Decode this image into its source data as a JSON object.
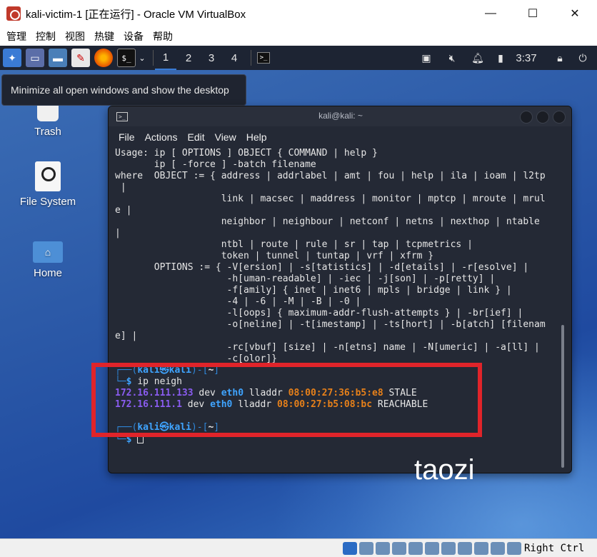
{
  "window": {
    "title": "kali-victim-1 [正在运行] - Oracle VM VirtualBox",
    "minimize": "—",
    "maximize": "☐",
    "close": "✕"
  },
  "menubar": [
    "管理",
    "控制",
    "视图",
    "热键",
    "设备",
    "帮助"
  ],
  "panel": {
    "workspaces": [
      "1",
      "2",
      "3",
      "4"
    ],
    "active_workspace": "1",
    "clock": "3:37",
    "icons": [
      "kali-menu-icon",
      "show-desktop-icon",
      "files-icon",
      "text-editor-icon",
      "firefox-icon",
      "terminal-icon",
      "chevron-down-icon",
      "terminal-task-icon",
      "network-icon",
      "mute-icon",
      "notification-icon",
      "battery-icon",
      "lock-icon",
      "power-icon"
    ]
  },
  "tooltip": "Minimize all open windows and show the desktop",
  "desktop": {
    "trash": "Trash",
    "filesystem": "File System",
    "home": "Home"
  },
  "terminal": {
    "title": "kali@kali: ~",
    "menu": [
      "File",
      "Actions",
      "Edit",
      "View",
      "Help"
    ],
    "usage_lines": [
      "Usage: ip [ OPTIONS ] OBJECT { COMMAND | help }",
      "       ip [ -force ] -batch filename",
      "where  OBJECT := { address | addrlabel | amt | fou | help | ila | ioam | l2tp",
      " |",
      "                   link | macsec | maddress | monitor | mptcp | mroute | mrul",
      "e |",
      "                   neighbor | neighbour | netconf | netns | nexthop | ntable",
      "|",
      "                   ntbl | route | rule | sr | tap | tcpmetrics |",
      "                   token | tunnel | tuntap | vrf | xfrm }",
      "       OPTIONS := { -V[ersion] | -s[tatistics] | -d[etails] | -r[esolve] |",
      "                    -h[uman-readable] | -iec | -j[son] | -p[retty] |",
      "                    -f[amily] { inet | inet6 | mpls | bridge | link } |",
      "                    -4 | -6 | -M | -B | -0 |",
      "                    -l[oops] { maximum-addr-flush-attempts } | -br[ief] |",
      "                    -o[neline] | -t[imestamp] | -ts[hort] | -b[atch] [filenam",
      "e] |",
      "                    -rc[vbuf] [size] | -n[etns] name | -N[umeric] | -a[ll] |",
      "                    -c[olor]}"
    ],
    "prompt_user": "kali",
    "prompt_at": "㉿",
    "prompt_host": "kali",
    "prompt_dir": "~",
    "command": "ip neigh",
    "neigh": [
      {
        "ip": "172.16.111.133",
        "dev_kw": "dev",
        "dev": "eth0",
        "lladdr_kw": "lladdr",
        "mac": "08:00:27:36:b5:e8",
        "state": "STALE"
      },
      {
        "ip": "172.16.111.1",
        "dev_kw": "dev",
        "dev": "eth0",
        "lladdr_kw": "lladdr",
        "mac": "08:00:27:b5:08:bc",
        "state": "REACHABLE"
      }
    ]
  },
  "watermark": "taozi",
  "statusbar": {
    "host_key": "Right Ctrl"
  },
  "colors": {
    "highlight": "#e0242a",
    "prompt": "#2f86d8",
    "ip": "#8a5cf0",
    "mac": "#e6801a",
    "iface": "#3fa4ff"
  }
}
